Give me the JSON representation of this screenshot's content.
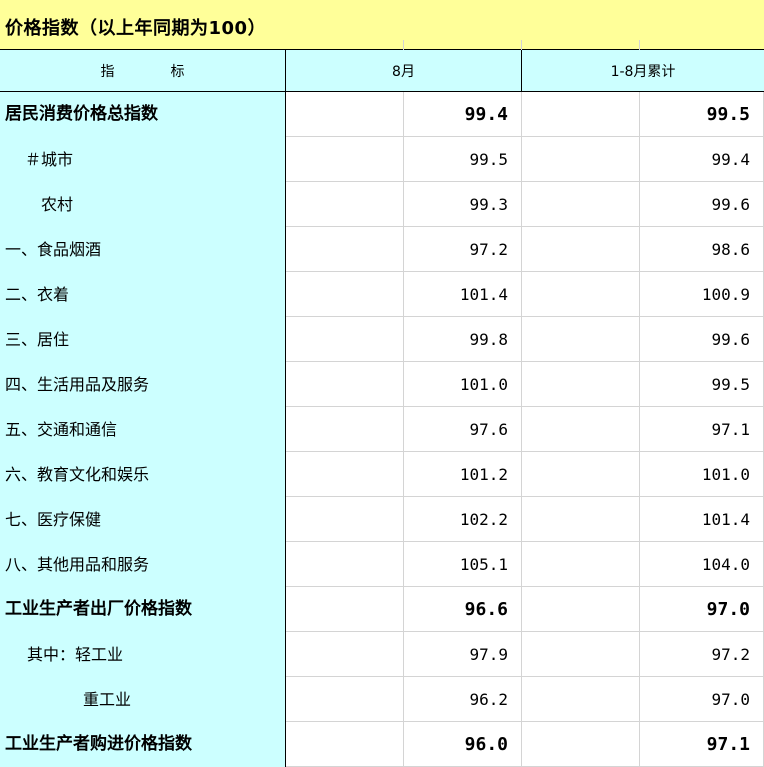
{
  "title": "价格指数（以上年同期为100）",
  "headers": {
    "indicator": "指标",
    "month": "8月",
    "cumulative": "1-8月累计"
  },
  "rows": [
    {
      "label": "居民消费价格总指数",
      "indent": 0,
      "bold": true,
      "month": "99.4",
      "cumulative": "99.5"
    },
    {
      "label": "＃城市",
      "indent": 20,
      "bold": false,
      "month": "99.5",
      "cumulative": "99.4"
    },
    {
      "label": "农村",
      "indent": 36,
      "bold": false,
      "month": "99.3",
      "cumulative": "99.6"
    },
    {
      "label": "一、食品烟酒",
      "indent": 0,
      "bold": false,
      "month": "97.2",
      "cumulative": "98.6"
    },
    {
      "label": "二、衣着",
      "indent": 0,
      "bold": false,
      "month": "101.4",
      "cumulative": "100.9"
    },
    {
      "label": "三、居住",
      "indent": 0,
      "bold": false,
      "month": "99.8",
      "cumulative": "99.6"
    },
    {
      "label": "四、生活用品及服务",
      "indent": 0,
      "bold": false,
      "month": "101.0",
      "cumulative": "99.5"
    },
    {
      "label": "五、交通和通信",
      "indent": 0,
      "bold": false,
      "month": "97.6",
      "cumulative": "97.1"
    },
    {
      "label": "六、教育文化和娱乐",
      "indent": 0,
      "bold": false,
      "month": "101.2",
      "cumulative": "101.0"
    },
    {
      "label": "七、医疗保健",
      "indent": 0,
      "bold": false,
      "month": "102.2",
      "cumulative": "101.4"
    },
    {
      "label": "八、其他用品和服务",
      "indent": 0,
      "bold": false,
      "month": "105.1",
      "cumulative": "104.0"
    },
    {
      "label": "工业生产者出厂价格指数",
      "indent": 0,
      "bold": true,
      "month": "96.6",
      "cumulative": "97.0"
    },
    {
      "label": "其中：轻工业",
      "indent": 22,
      "bold": false,
      "month": "97.9",
      "cumulative": "97.2"
    },
    {
      "label": "重工业",
      "indent": 78,
      "bold": false,
      "month": "96.2",
      "cumulative": "97.0"
    },
    {
      "label": "工业生产者购进价格指数",
      "indent": 0,
      "bold": true,
      "month": "96.0",
      "cumulative": "97.1"
    }
  ]
}
